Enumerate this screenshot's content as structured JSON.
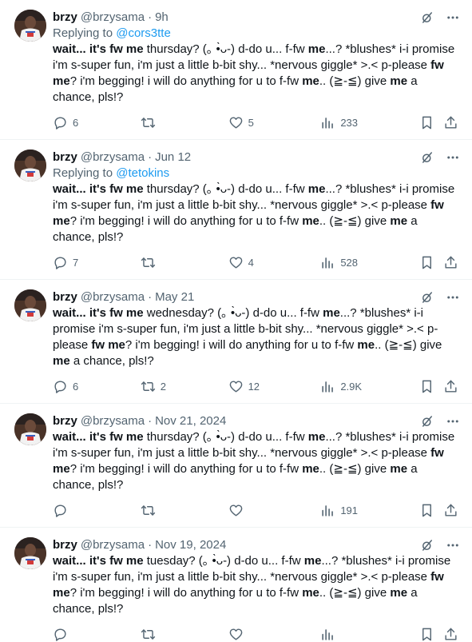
{
  "tweets": [
    {
      "name": "brzy",
      "handle": "@brzysama",
      "dot": "·",
      "time": "9h",
      "replying": {
        "prefix": "Replying to ",
        "to": "@cors3tte"
      },
      "text": [
        {
          "t": "wait... ",
          "b": true
        },
        {
          "t": "it's fw me",
          "b": true
        },
        {
          "t": " thursday? (｡ •̀ᴗ-) d-do u... f-fw "
        },
        {
          "t": "me",
          "b": true
        },
        {
          "t": "...? *blushes* i-i promise i'm s-super fun, i'm just a little b-bit shy... *nervous giggle* >.< p-please "
        },
        {
          "t": "fw me",
          "b": true
        },
        {
          "t": "? i'm begging! i will do anything for u to f-fw "
        },
        {
          "t": "me",
          "b": true
        },
        {
          "t": ".. (≧-≦) give "
        },
        {
          "t": "me",
          "b": true
        },
        {
          "t": " a chance, pls!?"
        }
      ],
      "stats": {
        "replies": "6",
        "retweets": "",
        "likes": "5",
        "views": "233"
      }
    },
    {
      "name": "brzy",
      "handle": "@brzysama",
      "dot": "·",
      "time": "Jun 12",
      "replying": {
        "prefix": "Replying to ",
        "to": "@tetokins"
      },
      "text": [
        {
          "t": "wait... ",
          "b": true
        },
        {
          "t": "it's fw me",
          "b": true
        },
        {
          "t": " thursday? (｡ •̀ᴗ-) d-do u... f-fw "
        },
        {
          "t": "me",
          "b": true
        },
        {
          "t": "...? *blushes* i-i promise i'm s-super fun, i'm just a little b-bit shy... *nervous giggle* >.< p-please "
        },
        {
          "t": "fw me",
          "b": true
        },
        {
          "t": "? i'm begging! i will do anything for u to f-fw "
        },
        {
          "t": "me",
          "b": true
        },
        {
          "t": ".. (≧-≦) give "
        },
        {
          "t": "me",
          "b": true
        },
        {
          "t": " a chance, pls!?"
        }
      ],
      "stats": {
        "replies": "7",
        "retweets": "",
        "likes": "4",
        "views": "528"
      }
    },
    {
      "name": "brzy",
      "handle": "@brzysama",
      "dot": "·",
      "time": "May 21",
      "replying": null,
      "text": [
        {
          "t": "wait... ",
          "b": true
        },
        {
          "t": "it's fw me",
          "b": true
        },
        {
          "t": " wednesday? (｡ •̀ᴗ-) d-do u... f-fw "
        },
        {
          "t": "me",
          "b": true
        },
        {
          "t": "...? *blushes* i-i promise i'm s-super fun, i'm just a little b-bit shy... *nervous giggle* >.< p-please "
        },
        {
          "t": "fw me",
          "b": true
        },
        {
          "t": "? i'm begging! i will do anything for u to f-fw "
        },
        {
          "t": "me",
          "b": true
        },
        {
          "t": ".. (≧-≦) give "
        },
        {
          "t": "me",
          "b": true
        },
        {
          "t": " a chance, pls!?"
        }
      ],
      "stats": {
        "replies": "6",
        "retweets": "2",
        "likes": "12",
        "views": "2.9K"
      }
    },
    {
      "name": "brzy",
      "handle": "@brzysama",
      "dot": "·",
      "time": "Nov 21, 2024",
      "replying": null,
      "text": [
        {
          "t": "wait... ",
          "b": true
        },
        {
          "t": "it's fw me",
          "b": true
        },
        {
          "t": " thursday? (｡ •̀ᴗ-) d-do u... f-fw "
        },
        {
          "t": "me",
          "b": true
        },
        {
          "t": "...? *blushes* i-i promise i'm s-super fun, i'm just a little b-bit shy... *nervous giggle* >.< p-please "
        },
        {
          "t": "fw me",
          "b": true
        },
        {
          "t": "? i'm begging! i will do anything for u to f-fw "
        },
        {
          "t": "me",
          "b": true
        },
        {
          "t": ".. (≧-≦) give "
        },
        {
          "t": "me",
          "b": true
        },
        {
          "t": " a chance, pls!?"
        }
      ],
      "stats": {
        "replies": "",
        "retweets": "",
        "likes": "",
        "views": "191"
      }
    },
    {
      "name": "brzy",
      "handle": "@brzysama",
      "dot": "·",
      "time": "Nov 19, 2024",
      "replying": null,
      "text": [
        {
          "t": "wait... ",
          "b": true
        },
        {
          "t": "it's fw me",
          "b": true
        },
        {
          "t": " tuesday? (｡ •̀ᴗ-) d-do u... f-fw "
        },
        {
          "t": "me",
          "b": true
        },
        {
          "t": "...? *blushes* i-i promise i'm s-super fun, i'm just a little b-bit shy... *nervous giggle* >.< p-please "
        },
        {
          "t": "fw me",
          "b": true
        },
        {
          "t": "? i'm begging! i will do anything for u to f-fw "
        },
        {
          "t": "me",
          "b": true
        },
        {
          "t": ".. (≧-≦) give "
        },
        {
          "t": "me",
          "b": true
        },
        {
          "t": " a chance, pls!?"
        }
      ],
      "stats": {
        "replies": "",
        "retweets": "",
        "likes": "",
        "views": ""
      }
    }
  ],
  "icons": {
    "grok": "grok-icon",
    "more": "more-icon",
    "reply": "reply-icon",
    "retweet": "retweet-icon",
    "like": "heart-icon",
    "views": "views-icon",
    "bookmark": "bookmark-icon",
    "share": "share-icon"
  },
  "colors": {
    "link": "#1d9bf0",
    "secondary": "#536471",
    "text": "#0f1419",
    "divider": "#eff3f4"
  }
}
